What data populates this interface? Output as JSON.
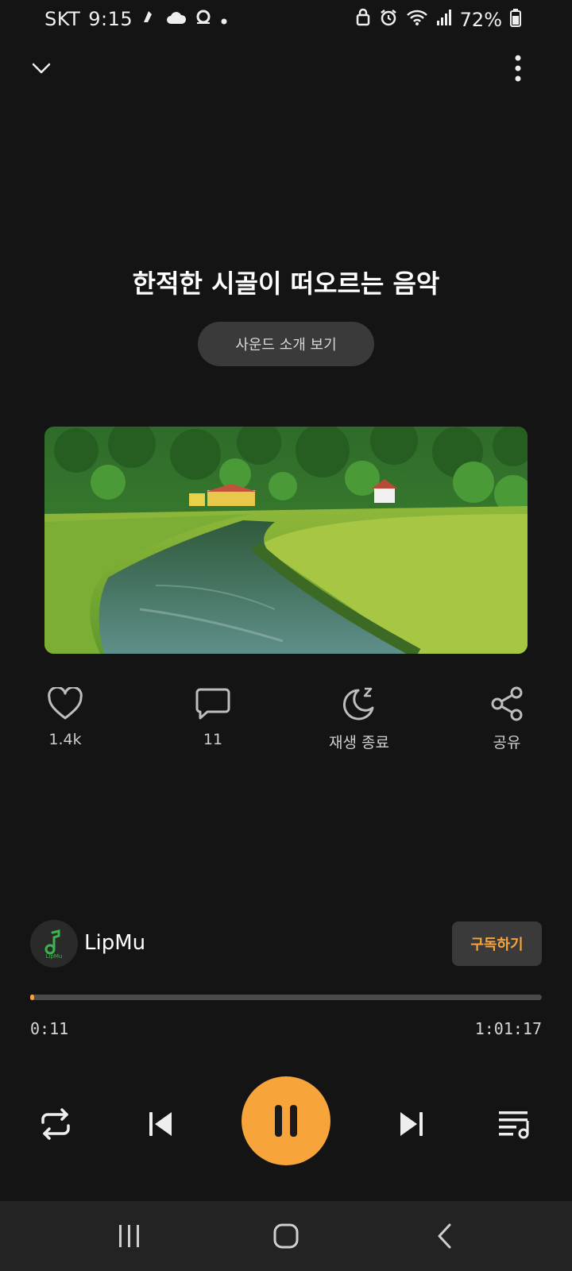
{
  "status_bar": {
    "carrier": "SKT",
    "time": "9:15",
    "battery": "72%",
    "icons": [
      "cloud-icon",
      "wifi-icon",
      "alarm-icon",
      "signal-icon",
      "battery-icon"
    ]
  },
  "player": {
    "title": "한적한 시골이 떠오르는 음악",
    "intro_button": "사운드 소개 보기",
    "actions": {
      "like_count": "1.4k",
      "comment_count": "11",
      "sleep_timer_label": "재생 종료",
      "share_label": "공유"
    },
    "channel": {
      "name": "LipMu",
      "subscribe_label": "구독하기"
    },
    "progress": {
      "elapsed": "0:11",
      "total": "1:01:17",
      "fraction": 0.003
    }
  },
  "colors": {
    "accent": "#f7a43a",
    "background": "#141414",
    "surface": "#3a3a3a"
  }
}
